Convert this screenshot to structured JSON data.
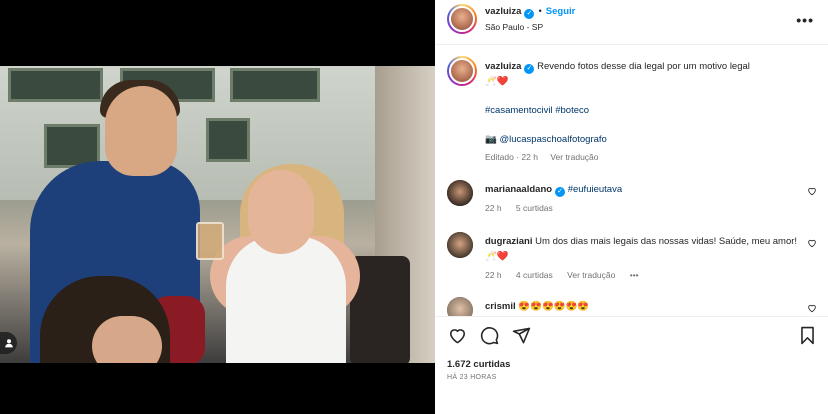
{
  "post": {
    "author": "vazluiza",
    "follow_label": "Seguir",
    "location": "São Paulo - SP",
    "more_label": "•••",
    "caption": "Revendo fotos desse dia legal por um motivo legal",
    "caption_emojis": "🥂❤️",
    "hashtags": "#casamentocivil #boteco",
    "photo_credit": "📷 @lucaspaschoalfotografo",
    "edited_meta": "Editado · 22 h",
    "see_translation": "Ver tradução",
    "tag_icon_label": "👤"
  },
  "comments": [
    {
      "user": "marianaaldano",
      "verified": true,
      "text": "#eufuieutava",
      "time": "22 h",
      "likes": "5 curtidas"
    },
    {
      "user": "dugraziani",
      "verified": false,
      "text": "Um dos dias mais legais das nossas vidas! Saúde, meu amor!",
      "text_emojis": "🥂❤️",
      "time": "22 h",
      "likes": "4 curtidas",
      "see_translation": "Ver tradução",
      "more_label": "•••"
    },
    {
      "user": "crismil",
      "verified": false,
      "text": "😍😍😍😍😍😍"
    }
  ],
  "footer": {
    "likes": "1.672 curtidas",
    "time": "HÁ 23 HORAS"
  },
  "icons": {
    "like": "heart-icon",
    "comment": "comment-icon",
    "share": "paper-plane-icon",
    "save": "bookmark-icon",
    "more": "more-options-icon",
    "verified": "verified-badge-icon",
    "tag": "user-tag-icon"
  },
  "colors": {
    "accent": "#0095f6",
    "link": "#00376b",
    "muted": "#737373",
    "heart": "#ed4956"
  }
}
